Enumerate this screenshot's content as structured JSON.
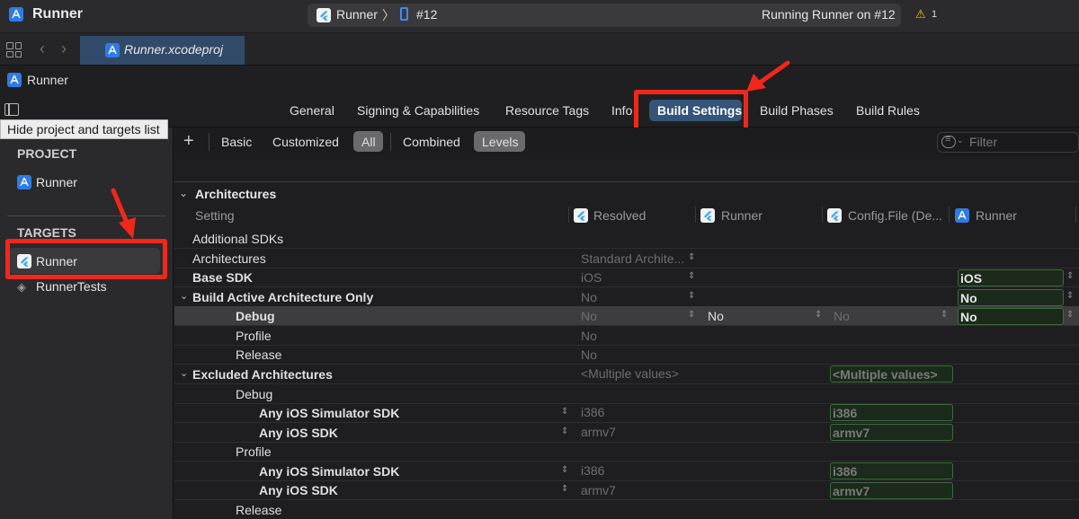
{
  "titlebar": {
    "app_name": "Runner",
    "scheme_target": "Runner",
    "scheme_separator": "〉",
    "scheme_device": "#12",
    "status": "Running Runner on #12",
    "warning_count": "1"
  },
  "tabbar": {
    "file_tab": "Runner.xcodeproj"
  },
  "breadcrumb": {
    "label": "Runner"
  },
  "editor_tabs": [
    "General",
    "Signing & Capabilities",
    "Resource Tags",
    "Info",
    "Build Settings",
    "Build Phases",
    "Build Rules"
  ],
  "tooltip": "Hide project and targets list",
  "sidebar": {
    "project_header": "PROJECT",
    "project_item": "Runner",
    "targets_header": "TARGETS",
    "target_items": [
      "Runner",
      "RunnerTests"
    ]
  },
  "filter_bar": {
    "plus": "+",
    "buttons": [
      "Basic",
      "Customized",
      "All",
      "Combined",
      "Levels"
    ],
    "filter_placeholder": "Filter"
  },
  "settings": {
    "section": "Architectures",
    "columns": [
      "Setting",
      "Resolved",
      "Runner",
      "Config.File (De...",
      "Runner"
    ],
    "rows": [
      {
        "label": "Additional SDKs",
        "resolved": "",
        "level_runner": "",
        "config": "",
        "target": ""
      },
      {
        "label": "Architectures",
        "resolved": "Standard Archite...",
        "level_runner": "",
        "config": "",
        "target": ""
      },
      {
        "label": "Base SDK",
        "resolved": "iOS",
        "level_runner": "",
        "config": "",
        "target": "iOS"
      },
      {
        "label": "Build Active Architecture Only",
        "resolved": "No",
        "level_runner": "",
        "config": "",
        "target": "No"
      },
      {
        "label": "Debug",
        "resolved": "No",
        "level_runner": "No",
        "config": "No",
        "target": "No"
      },
      {
        "label": "Profile",
        "resolved": "No",
        "level_runner": "",
        "config": "",
        "target": ""
      },
      {
        "label": "Release",
        "resolved": "No",
        "level_runner": "",
        "config": "",
        "target": ""
      },
      {
        "label": "Excluded Architectures",
        "resolved": "<Multiple values>",
        "level_runner": "",
        "config": "<Multiple values>",
        "target": ""
      },
      {
        "label": "Debug",
        "resolved": "",
        "level_runner": "",
        "config": "",
        "target": ""
      },
      {
        "label": "Any iOS Simulator SDK",
        "resolved": "i386",
        "level_runner": "",
        "config": "i386",
        "target": ""
      },
      {
        "label": "Any iOS SDK",
        "resolved": "armv7",
        "level_runner": "",
        "config": "armv7",
        "target": ""
      },
      {
        "label": "Profile",
        "resolved": "",
        "level_runner": "",
        "config": "",
        "target": ""
      },
      {
        "label": "Any iOS Simulator SDK",
        "resolved": "i386",
        "level_runner": "",
        "config": "i386",
        "target": ""
      },
      {
        "label": "Any iOS SDK",
        "resolved": "armv7",
        "level_runner": "",
        "config": "armv7",
        "target": ""
      },
      {
        "label": "Release",
        "resolved": "",
        "level_runner": "",
        "config": "",
        "target": ""
      }
    ]
  },
  "icons": {
    "app": "xcode-app-icon",
    "flutter": "flutter-icon",
    "warning": "warning-icon"
  },
  "colors": {
    "highlight": "#f2271b",
    "selected_tab": "#345478",
    "accent": "#2f7be6"
  }
}
